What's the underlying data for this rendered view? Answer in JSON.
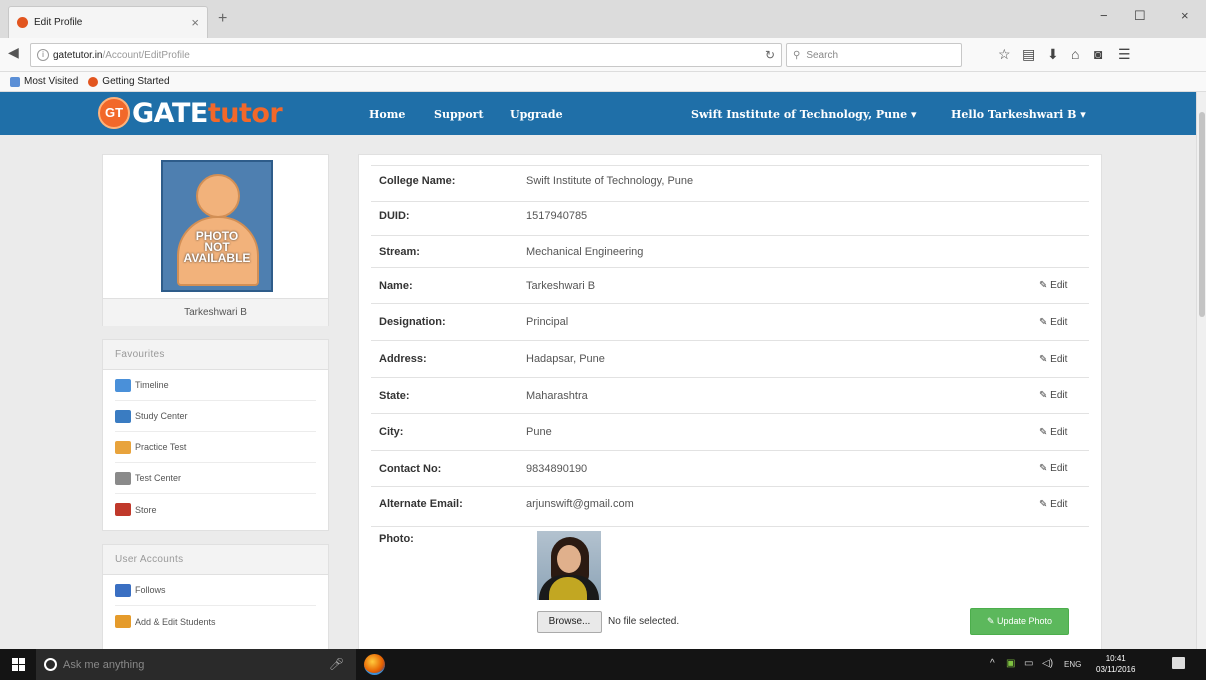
{
  "browser": {
    "tab_title": "Edit Profile",
    "tab_close": "×",
    "new_tab": "+",
    "win_min": "−",
    "win_max": "☐",
    "win_close": "×",
    "url_host": "gatetutor.in",
    "url_path": "/Account/EditProfile",
    "search_placeholder": "Search",
    "bookmarks": [
      "Most Visited",
      "Getting Started"
    ]
  },
  "site": {
    "logo_badge": "GT",
    "logo_gate": "GATE",
    "logo_tutor": "tutor",
    "nav": {
      "home": "Home",
      "support": "Support",
      "upgrade": "Upgrade",
      "college": "Swift Institute of Technology, Pune ▾",
      "user": "Hello Tarkeshwari B ▾"
    }
  },
  "sidebar": {
    "photo_placeholder": [
      "PHOTO",
      "NOT",
      "AVAILABLE"
    ],
    "name": "Tarkeshwari B",
    "favourites_title": "Favourites",
    "favourites": [
      {
        "label": "Timeline",
        "icon": "timeline-icon",
        "color": "#4a90d9"
      },
      {
        "label": "Study Center",
        "icon": "study-center-icon",
        "color": "#3a7cc2"
      },
      {
        "label": "Practice Test",
        "icon": "practice-test-icon",
        "color": "#e8a33c"
      },
      {
        "label": "Test Center",
        "icon": "test-center-icon",
        "color": "#8a8a8a"
      },
      {
        "label": "Store",
        "icon": "store-icon",
        "color": "#c0392b"
      }
    ],
    "user_accounts_title": "User Accounts",
    "user_accounts": [
      {
        "label": "Follows",
        "icon": "follows-icon",
        "color": "#3a6fc2"
      },
      {
        "label": "Add & Edit Students",
        "icon": "add-students-icon",
        "color": "#e59b2b"
      }
    ]
  },
  "profile": {
    "edit_label": "Edit",
    "rows": [
      {
        "label": "College Name:",
        "value": "Swift Institute of Technology, Pune",
        "editable": false
      },
      {
        "label": "DUID:",
        "value": "1517940785",
        "editable": false
      },
      {
        "label": "Stream:",
        "value": "Mechanical Engineering",
        "editable": false
      },
      {
        "label": "Name:",
        "value": "Tarkeshwari B",
        "editable": true
      },
      {
        "label": "Designation:",
        "value": "Principal",
        "editable": true
      },
      {
        "label": "Address:",
        "value": "Hadapsar, Pune",
        "editable": true
      },
      {
        "label": "State:",
        "value": "Maharashtra",
        "editable": true
      },
      {
        "label": "City:",
        "value": "Pune",
        "editable": true
      },
      {
        "label": "Contact No:",
        "value": "9834890190",
        "editable": true
      },
      {
        "label": "Alternate Email:",
        "value": "arjunswift@gmail.com",
        "editable": true
      }
    ],
    "photo_label": "Photo:",
    "browse_label": "Browse...",
    "no_file": "No file selected.",
    "update_photo": "Update Photo"
  },
  "taskbar": {
    "search_text": "Ask me anything",
    "tray_lang": "ENG",
    "time": "10:41",
    "date": "03/11/2016"
  }
}
